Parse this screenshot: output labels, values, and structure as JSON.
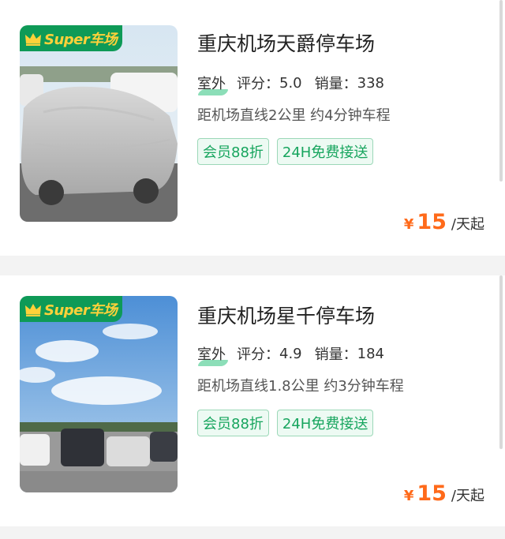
{
  "badge_text": "Super车场",
  "colors": {
    "brand_green": "#0e9a57",
    "badge_text": "#ffd13a",
    "tag_green": "#17a55e",
    "price_orange": "#ff6a1a"
  },
  "listings": [
    {
      "title": "重庆机场天爵停车场",
      "type": "室外",
      "rating_label": "评分：",
      "rating": "5.0",
      "sales_label": "销量：",
      "sales": "338",
      "distance": "距机场直线2公里 约4分钟车程",
      "tags": [
        "会员88折",
        "24H免费接送"
      ],
      "currency": "¥",
      "price": "15",
      "price_unit": "/天起"
    },
    {
      "title": "重庆机场星千停车场",
      "type": "室外",
      "rating_label": "评分：",
      "rating": "4.9",
      "sales_label": "销量：",
      "sales": "184",
      "distance": "距机场直线1.8公里 约3分钟车程",
      "tags": [
        "会员88折",
        "24H免费接送"
      ],
      "currency": "¥",
      "price": "15",
      "price_unit": "/天起"
    }
  ]
}
